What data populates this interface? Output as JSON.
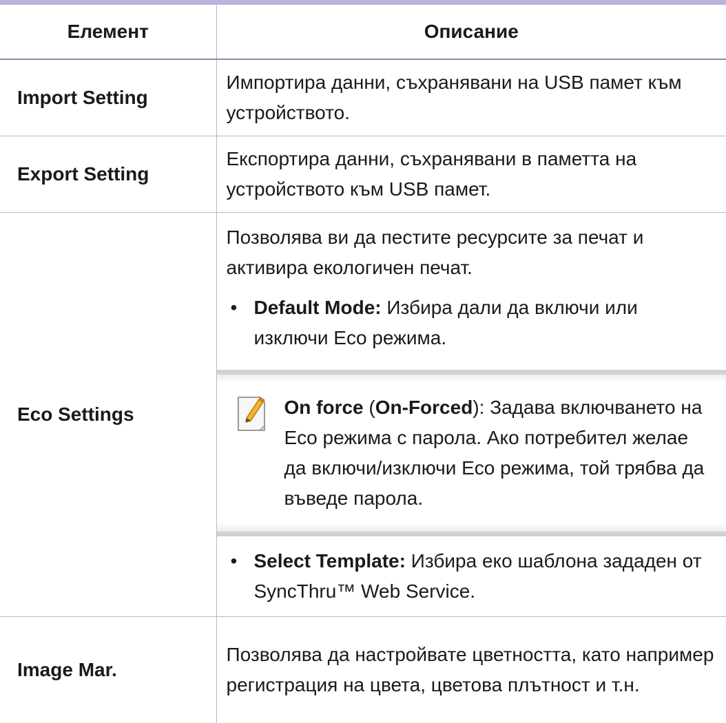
{
  "header": {
    "col_item": "Елемент",
    "col_desc": "Описание"
  },
  "rows": {
    "import": {
      "item": "Import Setting",
      "desc": "Импортира данни, съхранявани на USB памет към устройството."
    },
    "export": {
      "item": "Export Setting",
      "desc": "Експортира данни, съхранявани в паметта на устройството към USB памет."
    },
    "eco": {
      "item": "Eco Settings",
      "intro": "Позволява ви да пестите ресурсите за печат и активира екологичен печат.",
      "bullet1_label": "Default Mode:",
      "bullet1_text": " Избира дали да включи или изключи Eco режима.",
      "note_on": "On force",
      "note_open": " (",
      "note_forced": "On-Forced",
      "note_text": "): Задава включването на Eco режима с парола. Ако потребител желае да включи/изключи Eco режима, той трябва да въведе парола.",
      "bullet2_label": "Select Template:",
      "bullet2_text": " Избира еко шаблона зададен от SyncThru™ Web Service.",
      "bullet_symbol": "•",
      "note_icon": "note-pencil-icon"
    },
    "image": {
      "item": "Image Mar.",
      "desc": "Позволява да настройвате цветността, като например регистрация на цвета, цветова плътност и т.н."
    }
  },
  "colors": {
    "header_rule": "#b8b4dc",
    "grid_line": "#b9b7c6",
    "note_bar": "#d2d2d2"
  }
}
